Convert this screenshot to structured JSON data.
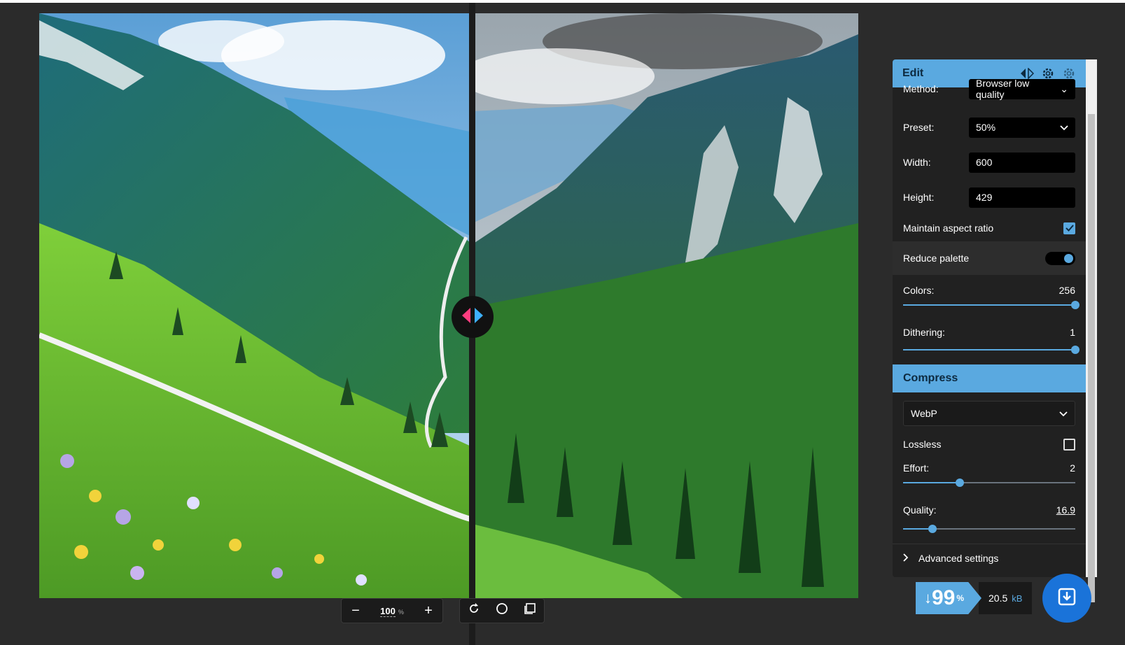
{
  "toolbar": {
    "zoom_value": "100",
    "zoom_unit": "%"
  },
  "panel": {
    "title": "Edit",
    "method_label": "Method:",
    "method_value": "Browser low quality",
    "preset_label": "Preset:",
    "preset_value": "50%",
    "width_label": "Width:",
    "width_value": "600",
    "height_label": "Height:",
    "height_value": "429",
    "maintain_aspect_label": "Maintain aspect ratio",
    "maintain_aspect_checked": true,
    "reduce_palette_label": "Reduce palette",
    "reduce_palette_on": true,
    "colors_label": "Colors:",
    "colors_value": "256",
    "colors_fraction": 1.0,
    "dithering_label": "Dithering:",
    "dithering_value": "1",
    "dithering_fraction": 1.0,
    "compress_title": "Compress",
    "format_value": "WebP",
    "lossless_label": "Lossless",
    "lossless_checked": false,
    "effort_label": "Effort:",
    "effort_value": "2",
    "effort_fraction": 0.33,
    "quality_label": "Quality:",
    "quality_value": "16.9",
    "quality_fraction": 0.169,
    "advanced_label": "Advanced settings"
  },
  "result": {
    "arrow": "↓",
    "percent_value": "99",
    "percent_sign": "%",
    "size_value": "20.5",
    "size_unit": "kB"
  },
  "colors": {
    "accent": "#5aa9e0",
    "panel_bg": "#212121",
    "save_button": "#1a73d9"
  },
  "icons": [
    "minus-icon",
    "plus-icon",
    "rotate-icon",
    "circle-icon",
    "crop-icon",
    "compare-icon",
    "settings-icon",
    "settings-secondary-icon",
    "chevron-down-icon",
    "chevron-right-icon",
    "save-icon",
    "divider-handle-icon"
  ]
}
